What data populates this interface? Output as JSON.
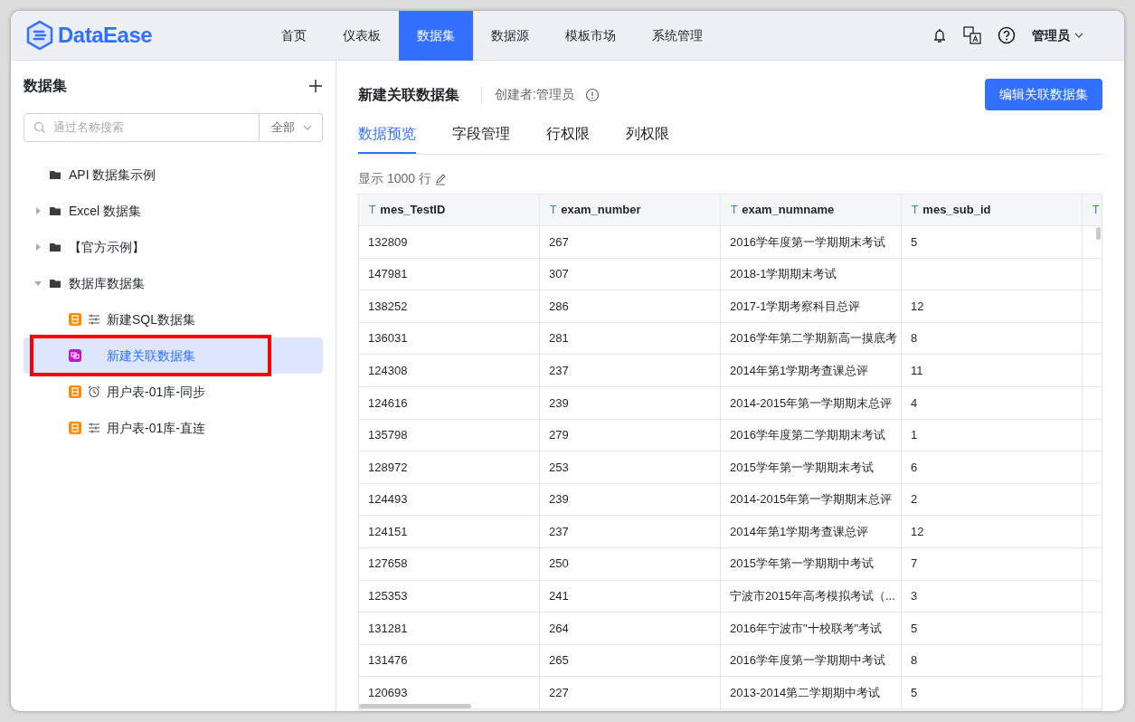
{
  "header": {
    "logo_text": "DataEase",
    "nav": [
      {
        "label": "首页",
        "selected": false
      },
      {
        "label": "仪表板",
        "selected": false
      },
      {
        "label": "数据集",
        "selected": true
      },
      {
        "label": "数据源",
        "selected": false
      },
      {
        "label": "模板市场",
        "selected": false
      },
      {
        "label": "系统管理",
        "selected": false
      }
    ],
    "user": "管理员"
  },
  "sidebar": {
    "title": "数据集",
    "search": {
      "placeholder": "通过名称搜索"
    },
    "filter": "全部",
    "tree": [
      {
        "label": "API 数据集示例",
        "kind": "folder",
        "selected": false,
        "annotated": false
      },
      {
        "label": "Excel 数据集",
        "kind": "folder",
        "expanded": false,
        "selected": false,
        "annotated": false
      },
      {
        "label": "【官方示例】",
        "kind": "folder",
        "expanded": false,
        "selected": false,
        "annotated": false
      },
      {
        "label": "数据库数据集",
        "kind": "folder",
        "expanded": true,
        "selected": false,
        "annotated": false,
        "children": [
          {
            "label": "新建SQL数据集",
            "kind": "sql-direct",
            "selected": false,
            "annotated": false
          },
          {
            "label": "新建关联数据集",
            "kind": "union",
            "selected": true,
            "annotated": true
          },
          {
            "label": "用户表-01库-同步",
            "kind": "sql-sync",
            "selected": false,
            "annotated": false
          },
          {
            "label": "用户表-01库-直连",
            "kind": "sql-direct",
            "selected": false,
            "annotated": false
          }
        ]
      }
    ]
  },
  "main": {
    "title": "新建关联数据集",
    "creator": "创建者:管理员",
    "edit_button": "编辑关联数据集",
    "tabs": [
      {
        "label": "数据预览",
        "selected": true
      },
      {
        "label": "字段管理",
        "selected": false
      },
      {
        "label": "行权限",
        "selected": false
      },
      {
        "label": "列权限",
        "selected": false
      }
    ],
    "row_limit": "显示 1000 行",
    "table": {
      "columns": [
        {
          "type_icon": "T",
          "label": "mes_TestID"
        },
        {
          "type_icon": "T",
          "label": "exam_number"
        },
        {
          "type_icon": "T",
          "label": "exam_numname"
        },
        {
          "type_icon": "T",
          "label": "mes_sub_id"
        },
        {
          "type_icon": "T"
        }
      ],
      "rows": [
        [
          "132809",
          "267",
          "2016学年度第一学期期末考试",
          "5"
        ],
        [
          "147981",
          "307",
          "2018-1学期期末考试",
          null
        ],
        [
          "138252",
          "286",
          "2017-1学期考察科目总评",
          "12"
        ],
        [
          "136031",
          "281",
          "2016学年第二学期新高一摸底考",
          "8"
        ],
        [
          "124308",
          "237",
          "2014年第1学期考查课总评",
          "11"
        ],
        [
          "124616",
          "239",
          "2014-2015年第一学期期末总评",
          "4"
        ],
        [
          "135798",
          "279",
          "2016学年度第二学期期末考试",
          "1"
        ],
        [
          "128972",
          "253",
          "2015学年第一学期期末考试",
          "6"
        ],
        [
          "124493",
          "239",
          "2014-2015年第一学期期末总评",
          "2"
        ],
        [
          "124151",
          "237",
          "2014年第1学期考查课总评",
          "12"
        ],
        [
          "127658",
          "250",
          "2015学年第一学期期中考试",
          "7"
        ],
        [
          "125353",
          "241",
          "宁波市2015年高考模拟考试（...",
          "3"
        ],
        [
          "131281",
          "264",
          "2016年宁波市\"十校联考\"考试",
          "5"
        ],
        [
          "131476",
          "265",
          "2016学年度第一学期期中考试",
          "8"
        ],
        [
          "120693",
          "227",
          "2013-2014第二学期期中考试",
          "5"
        ]
      ]
    }
  }
}
